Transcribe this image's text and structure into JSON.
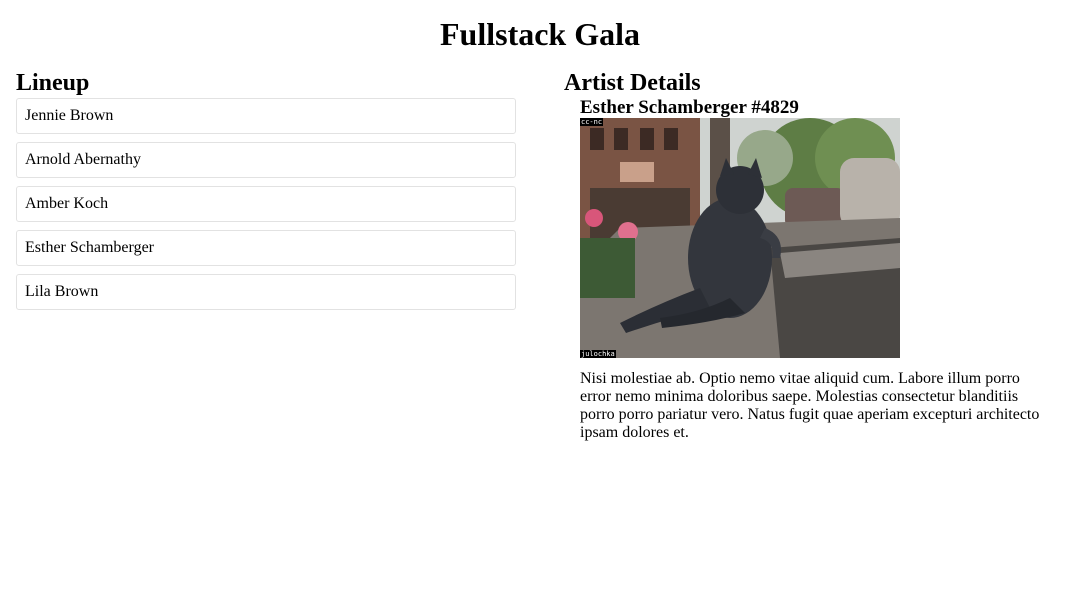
{
  "app": {
    "title": "Fullstack Gala"
  },
  "lineup": {
    "heading": "Lineup",
    "artists": [
      "Jennie Brown",
      "Arnold Abernathy",
      "Amber Koch",
      "Esther Schamberger",
      "Lila Brown"
    ]
  },
  "details": {
    "heading": "Artist Details",
    "artist_name": "Esther Schamberger #4829",
    "photo": {
      "alt": "Bronze cat statue lounging on a street curb",
      "license_tag": "cc-nc",
      "credit_tag": "julochka"
    },
    "bio": "Nisi molestiae ab. Optio nemo vitae aliquid cum. Labore illum porro error nemo minima doloribus saepe. Molestias consectetur blanditiis porro porro pariatur vero. Natus fugit quae aperiam excepturi architecto ipsam dolores et."
  }
}
